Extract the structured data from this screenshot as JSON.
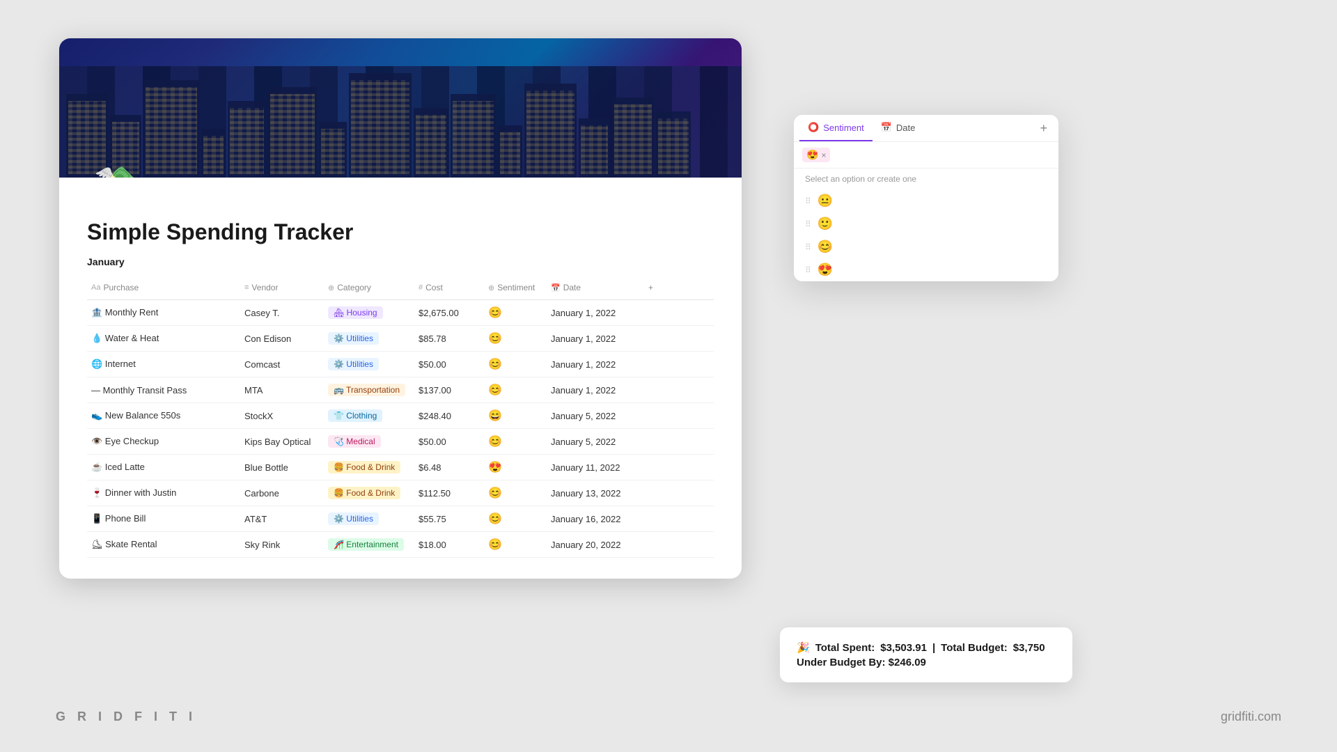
{
  "branding": {
    "left": "G R I D F I T I",
    "right": "gridfiti.com"
  },
  "page": {
    "title": "Simple Spending Tracker",
    "section": "January"
  },
  "columns": {
    "purchase": "Purchase",
    "vendor": "Vendor",
    "category": "Category",
    "cost": "Cost",
    "sentiment": "Sentiment",
    "date": "Date"
  },
  "rows": [
    {
      "purchase": "🏦 Monthly Rent",
      "vendor": "Casey T.",
      "category": "🏘 Housing",
      "categoryClass": "tag-housing",
      "cost": "$2,675.00",
      "sentiment": "😊",
      "date": "January 1, 2022"
    },
    {
      "purchase": "💧 Water & Heat",
      "vendor": "Con Edison",
      "category": "⚙️ Utilities",
      "categoryClass": "tag-utilities",
      "cost": "$85.78",
      "sentiment": "😊",
      "date": "January 1, 2022"
    },
    {
      "purchase": "🌐 Internet",
      "vendor": "Comcast",
      "category": "⚙️ Utilities",
      "categoryClass": "tag-utilities",
      "cost": "$50.00",
      "sentiment": "😊",
      "date": "January 1, 2022"
    },
    {
      "purchase": "— Monthly Transit Pass",
      "vendor": "MTA",
      "category": "🚌 Transportation",
      "categoryClass": "tag-transportation",
      "cost": "$137.00",
      "sentiment": "😊",
      "date": "January 1, 2022"
    },
    {
      "purchase": "👟 New Balance 550s",
      "vendor": "StockX",
      "category": "👕 Clothing",
      "categoryClass": "tag-clothing",
      "cost": "$248.40",
      "sentiment": "😄",
      "date": "January 5, 2022"
    },
    {
      "purchase": "👁️ Eye Checkup",
      "vendor": "Kips Bay Optical",
      "category": "🩺 Medical",
      "categoryClass": "tag-medical",
      "cost": "$50.00",
      "sentiment": "😊",
      "date": "January 5, 2022"
    },
    {
      "purchase": "☕ Iced Latte",
      "vendor": "Blue Bottle",
      "category": "🍔 Food & Drink",
      "categoryClass": "tag-food",
      "cost": "$6.48",
      "sentiment": "😍",
      "date": "January 11, 2022"
    },
    {
      "purchase": "🍷 Dinner with Justin",
      "vendor": "Carbone",
      "category": "🍔 Food & Drink",
      "categoryClass": "tag-food",
      "cost": "$112.50",
      "sentiment": "😊",
      "date": "January 13, 2022"
    },
    {
      "purchase": "📱 Phone Bill",
      "vendor": "AT&T",
      "category": "⚙️ Utilities",
      "categoryClass": "tag-utilities",
      "cost": "$55.75",
      "sentiment": "😊",
      "date": "January 16, 2022"
    },
    {
      "purchase": "⛸ Skate Rental",
      "vendor": "Sky Rink",
      "category": "🎢 Entertainment",
      "categoryClass": "tag-entertainment",
      "cost": "$18.00",
      "sentiment": "😊",
      "date": "January 20, 2022"
    }
  ],
  "dropdown": {
    "tabs": [
      {
        "label": "Sentiment",
        "icon": "⭕",
        "active": true
      },
      {
        "label": "Date",
        "icon": "📅",
        "active": false
      }
    ],
    "add_label": "+",
    "input_tag": "😍",
    "close_label": "×",
    "placeholder": "",
    "hint": "Select an option or create one",
    "options": [
      "😐",
      "🙂",
      "😊",
      "😍"
    ]
  },
  "budget": {
    "icon": "🎉",
    "total_spent_label": "Total Spent:",
    "total_spent_value": "$3,503.91",
    "separator": "|",
    "total_budget_label": "Total Budget:",
    "total_budget_value": "$3,750",
    "under_label": "Under Budget By:",
    "under_value": "$246.09"
  }
}
